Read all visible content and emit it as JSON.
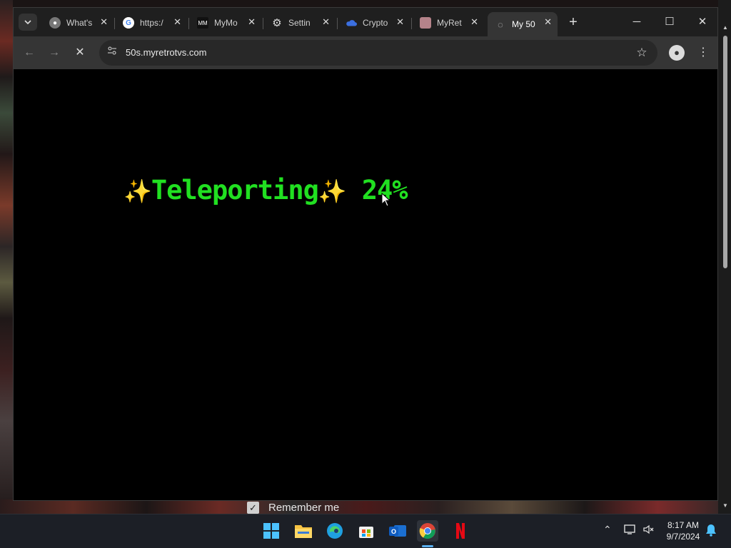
{
  "browser": {
    "tabs": [
      {
        "title": "What's",
        "icon": "chrome-icon"
      },
      {
        "title": "https:/",
        "icon": "google-icon"
      },
      {
        "title": "MyMo",
        "icon": "mymovies-icon"
      },
      {
        "title": "Settin",
        "icon": "gear-icon"
      },
      {
        "title": "Crypto",
        "icon": "cloud-icon"
      },
      {
        "title": "MyRet",
        "icon": "retro-tv-icon"
      },
      {
        "title": "My 50",
        "icon": "loading-icon",
        "active": true
      }
    ],
    "url": "50s.myretrotvs.com"
  },
  "page": {
    "loading_text": "Teleporting",
    "sparkle": "✨",
    "percent": "24%",
    "progress_value": 24
  },
  "remember": {
    "label": "Remember me",
    "checked": true
  },
  "taskbar": {
    "time": "8:17 AM",
    "date": "9/7/2024",
    "apps": [
      "windows-start-icon",
      "file-explorer-icon",
      "edge-icon",
      "store-icon",
      "outlook-icon",
      "chrome-icon",
      "netflix-icon"
    ]
  },
  "colors": {
    "loading_text": "#21e021",
    "sparkle": "#f7c948",
    "background": "#000000"
  }
}
